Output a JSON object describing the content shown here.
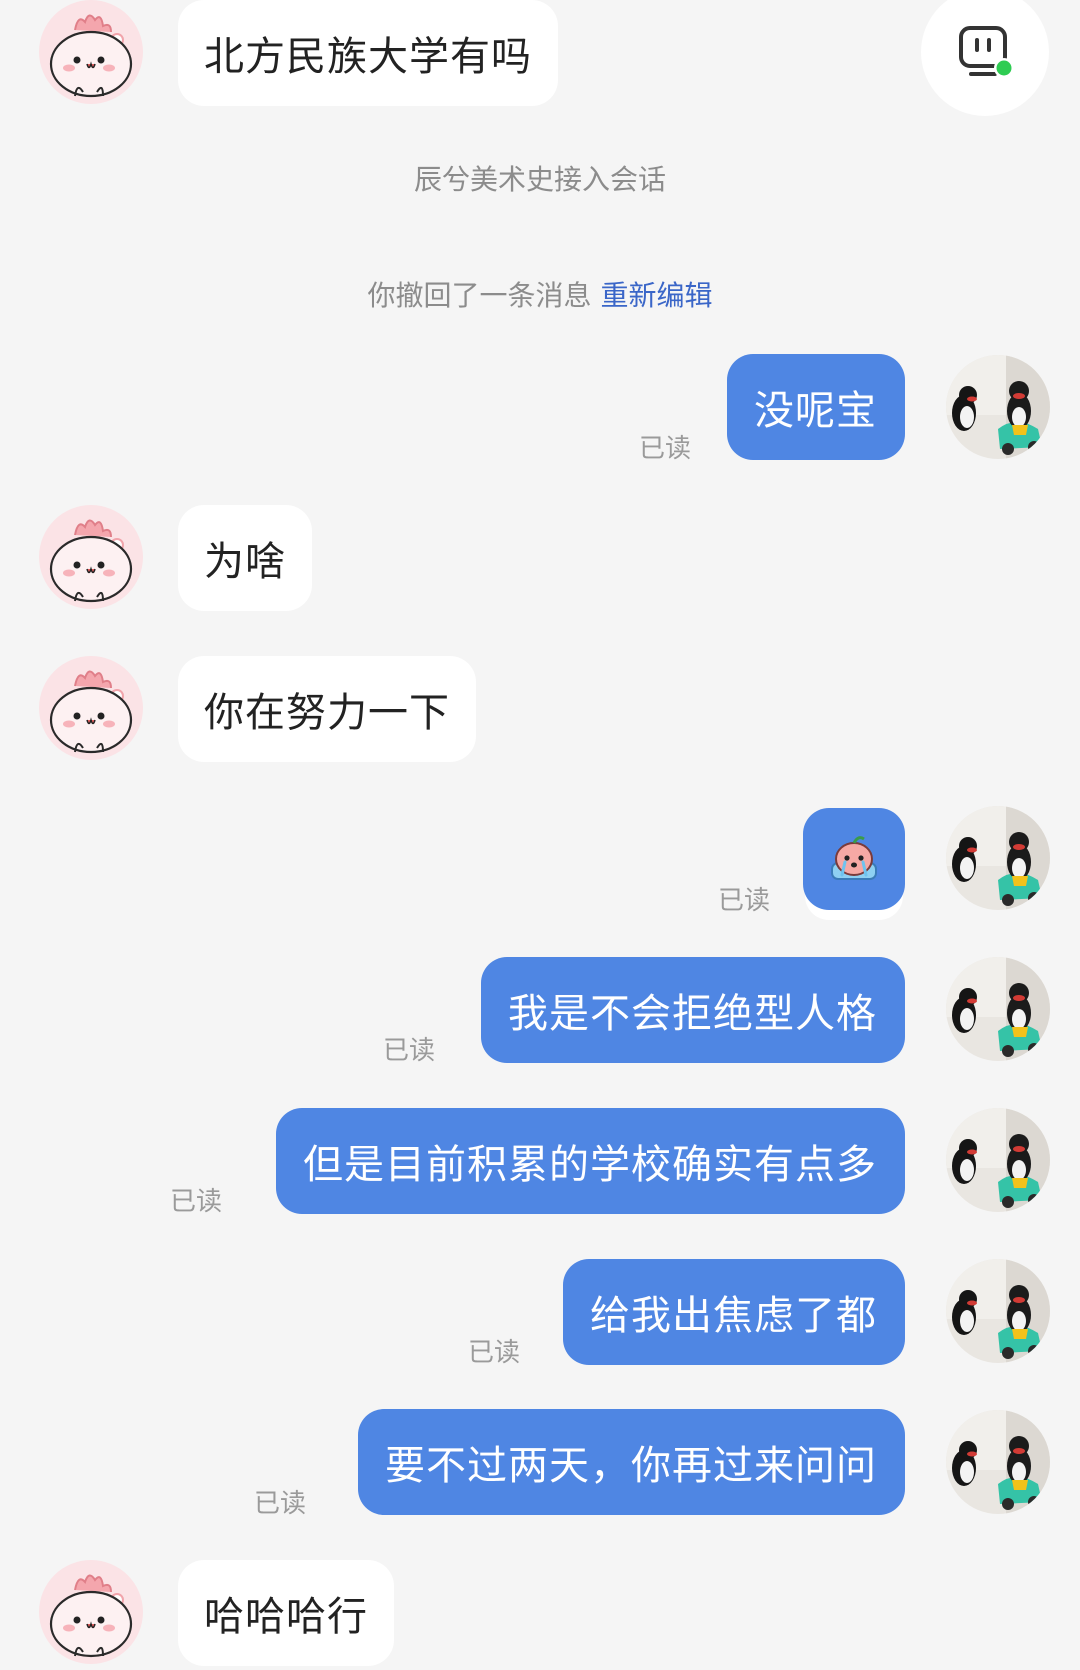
{
  "system": {
    "joined": "辰兮美术史接入会话",
    "recalled": "你撤回了一条消息",
    "reedit": "重新编辑"
  },
  "messages": {
    "m1": "北方民族大学有吗",
    "m2": "没呢宝",
    "m3": "为啥",
    "m4": "你在努力一下",
    "m6": "我是不会拒绝型人格",
    "m7": "但是目前积累的学校确实有点多",
    "m8": "给我出焦虑了都",
    "m9": "要不过两天，你再过来问问",
    "m10": "哈哈哈行"
  },
  "read_label": "已读",
  "icons": {
    "top_right": "service-monitor-icon",
    "sticker": "crying-peach-sticker-icon",
    "their_avatar": "pink-blob-avatar",
    "my_avatar": "penguin-photo-avatar"
  },
  "colors": {
    "outgoing_bubble": "#4f86e3",
    "incoming_bubble": "#ffffff",
    "background": "#f5f5f5",
    "link": "#3a66c8",
    "online_dot": "#2ecc52"
  }
}
